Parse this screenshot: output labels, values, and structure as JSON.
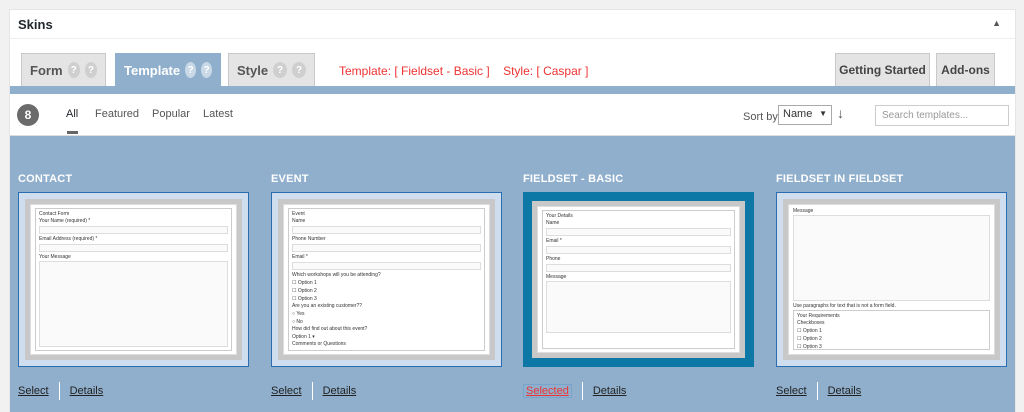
{
  "panel": {
    "title": "Skins",
    "collapse_icon": "caret-up-icon"
  },
  "tabs": [
    {
      "label": "Form"
    },
    {
      "label": "Template"
    },
    {
      "label": "Style"
    }
  ],
  "help_glyph": "?",
  "template_info": {
    "template": "Template: [ Fieldset - Basic ]",
    "style": "Style: [ Caspar ]"
  },
  "right_tabs": {
    "getting_started": "Getting Started",
    "addons": "Add-ons"
  },
  "filter": {
    "count": "8",
    "links": [
      "All",
      "Featured",
      "Popular",
      "Latest"
    ],
    "sort_label": "Sort by",
    "sort_value": "Name",
    "search_placeholder": "Search templates..."
  },
  "cards": [
    {
      "title": "CONTACT",
      "select": "Select",
      "details": "Details",
      "form": {
        "legend": "Contact Form",
        "fields": [
          "Your Name (required) *",
          "Email Address (required) *",
          "Your Message"
        ]
      }
    },
    {
      "title": "EVENT",
      "select": "Select",
      "details": "Details",
      "form": {
        "legend": "Event",
        "fields": [
          "Name",
          "Phone Number",
          "Email *"
        ],
        "q1": "Which workshops will you be attending?",
        "q1_options": [
          "Option 1",
          "Option 2",
          "Option 3"
        ],
        "q2": "Are you an existing customer??",
        "q2_options": [
          "Yes",
          "No"
        ],
        "q3": "How did find out about this event?",
        "q3_select": "Option 1",
        "q4": "Comments or Questions"
      }
    },
    {
      "title": "FIELDSET - BASIC",
      "select": "Selected",
      "details": "Details",
      "form": {
        "legend": "Your Details",
        "fields": [
          "Name",
          "Email *",
          "Phone",
          "Message"
        ]
      }
    },
    {
      "title": "FIELDSET IN FIELDSET",
      "select": "Select",
      "details": "Details",
      "form": {
        "top_label": "Message",
        "note": "Use paragraphs for text that is not a form field.",
        "legend": "Your Requirements",
        "checkboxes_label": "Checkboxes",
        "options": [
          "Option 1",
          "Option 2",
          "Option 3"
        ]
      }
    }
  ]
}
